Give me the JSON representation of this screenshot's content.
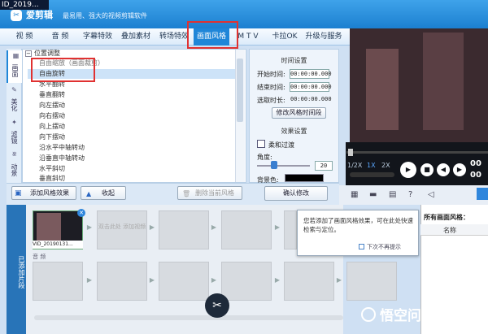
{
  "window": {
    "prev_title": "ID_2019...",
    "app_name": "爱剪辑",
    "tagline": "最易用、强大的视频剪辑软件"
  },
  "menu": {
    "tabs": [
      "视 频",
      "音 频",
      "字幕特效",
      "叠加素材",
      "转场特效",
      "画面风格",
      "M T V",
      "卡拉OK",
      "升级与服务"
    ],
    "active_tab": "画面风格"
  },
  "side_tabs": [
    {
      "label": "画面",
      "icon": "image-icon"
    },
    {
      "label": "美化",
      "icon": "brush-icon"
    },
    {
      "label": "滤镜",
      "icon": "wand-icon"
    },
    {
      "label": "动景",
      "icon": "wave-icon"
    }
  ],
  "effects_tree": {
    "category": "位置调整",
    "items": [
      "自由缩放（画面裁剪）",
      "自由旋转",
      "水平翻转",
      "垂直翻转",
      "向左摆动",
      "向右摆动",
      "向上摆动",
      "向下摆动",
      "沿水平中轴转动",
      "沿垂直中轴转动",
      "水平斜切",
      "垂直斜切"
    ],
    "selected": "自由旋转"
  },
  "time_settings": {
    "heading": "时间设置",
    "start_label": "开始时间:",
    "start_value": "00:00:00.000",
    "end_label": "结束时间:",
    "end_value": "00:00:00.000",
    "duration_label": "选取时长:",
    "duration_value": "00:00:00.000",
    "modify_button": "修改风格时间段"
  },
  "effect_settings": {
    "heading": "效果设置",
    "soft_transition": "柔和过渡",
    "angle_label": "角度:",
    "angle_value": "20",
    "angle_fraction": 0.33,
    "fill_color_label": "背景色:",
    "fill_color": "#000000"
  },
  "bottom_actions": {
    "add_effect": "添加风格效果",
    "collapse": "收起",
    "delete_current": "删除当前风格",
    "confirm": "确认修改"
  },
  "player": {
    "speeds": [
      "1/2X",
      "1X",
      "2X"
    ],
    "active_speed": "1X",
    "time_top": "00",
    "time_bottom": "00"
  },
  "timeline": {
    "side_label": "已添加片段",
    "clip_name": "VID_20190131...",
    "add_placeholder": "双击此处 添加视频",
    "audio_label": "音 频"
  },
  "popup": {
    "message": "您若添加了画面风格效果，可在此处快速检索与定位。",
    "dont_show": "下次不再提示"
  },
  "styles_pane": {
    "heading": "所有画面风格：",
    "col_name": "名称"
  },
  "watermark": "悟空问答",
  "colors": {
    "accent": "#1f86d8",
    "highlight_box": "#e03131",
    "selection": "#cde3f8"
  }
}
